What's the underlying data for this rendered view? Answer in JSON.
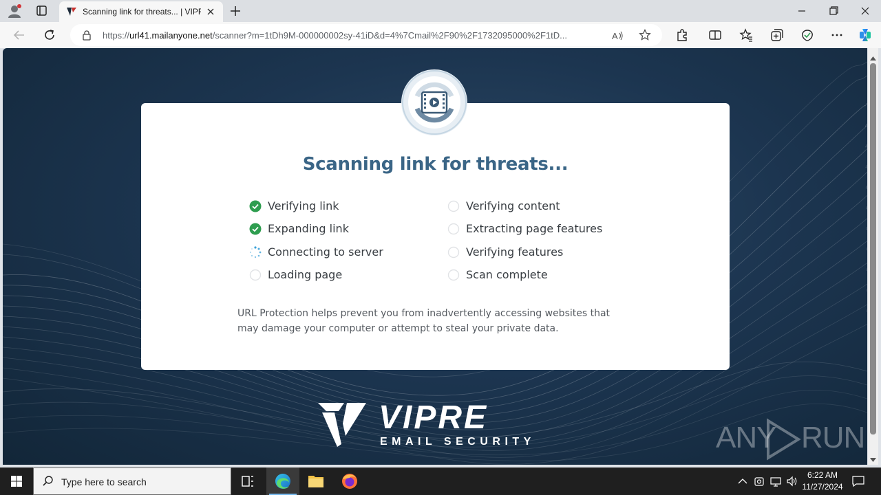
{
  "browser": {
    "tab": {
      "title": "Scanning link for threats... | VIPRE"
    },
    "url": {
      "prefix": "https://",
      "host": "url41.mailanyone.net",
      "rest": "/scanner?m=1tDh9M-000000002sy-41iD&d=4%7Cmail%2F90%2F1732095000%2F1tD..."
    }
  },
  "page": {
    "title": "Scanning link for threats...",
    "steps_left": [
      {
        "label": "Verifying link",
        "state": "done"
      },
      {
        "label": "Expanding link",
        "state": "done"
      },
      {
        "label": "Connecting to server",
        "state": "loading"
      },
      {
        "label": "Loading page",
        "state": "pending"
      }
    ],
    "steps_right": [
      {
        "label": "Verifying content",
        "state": "pending"
      },
      {
        "label": "Extracting page features",
        "state": "pending"
      },
      {
        "label": "Verifying features",
        "state": "pending"
      },
      {
        "label": "Scan complete",
        "state": "pending"
      }
    ],
    "description": "URL Protection helps prevent you from inadvertently accessing websites that may damage your computer or attempt to steal your private data.",
    "logo": {
      "word": "VIPRE",
      "sub": "EMAIL SECURITY"
    },
    "watermark": {
      "left": "ANY",
      "right": "RUN"
    }
  },
  "taskbar": {
    "search_placeholder": "Type here to search",
    "time": "6:22 AM",
    "date": "11/27/2024"
  },
  "colors": {
    "accent_title": "#3a6586",
    "done": "#2e9d4f",
    "loading": "#3aa0d8",
    "pending_ring": "#d9dcdf",
    "background": "#1c3550"
  }
}
